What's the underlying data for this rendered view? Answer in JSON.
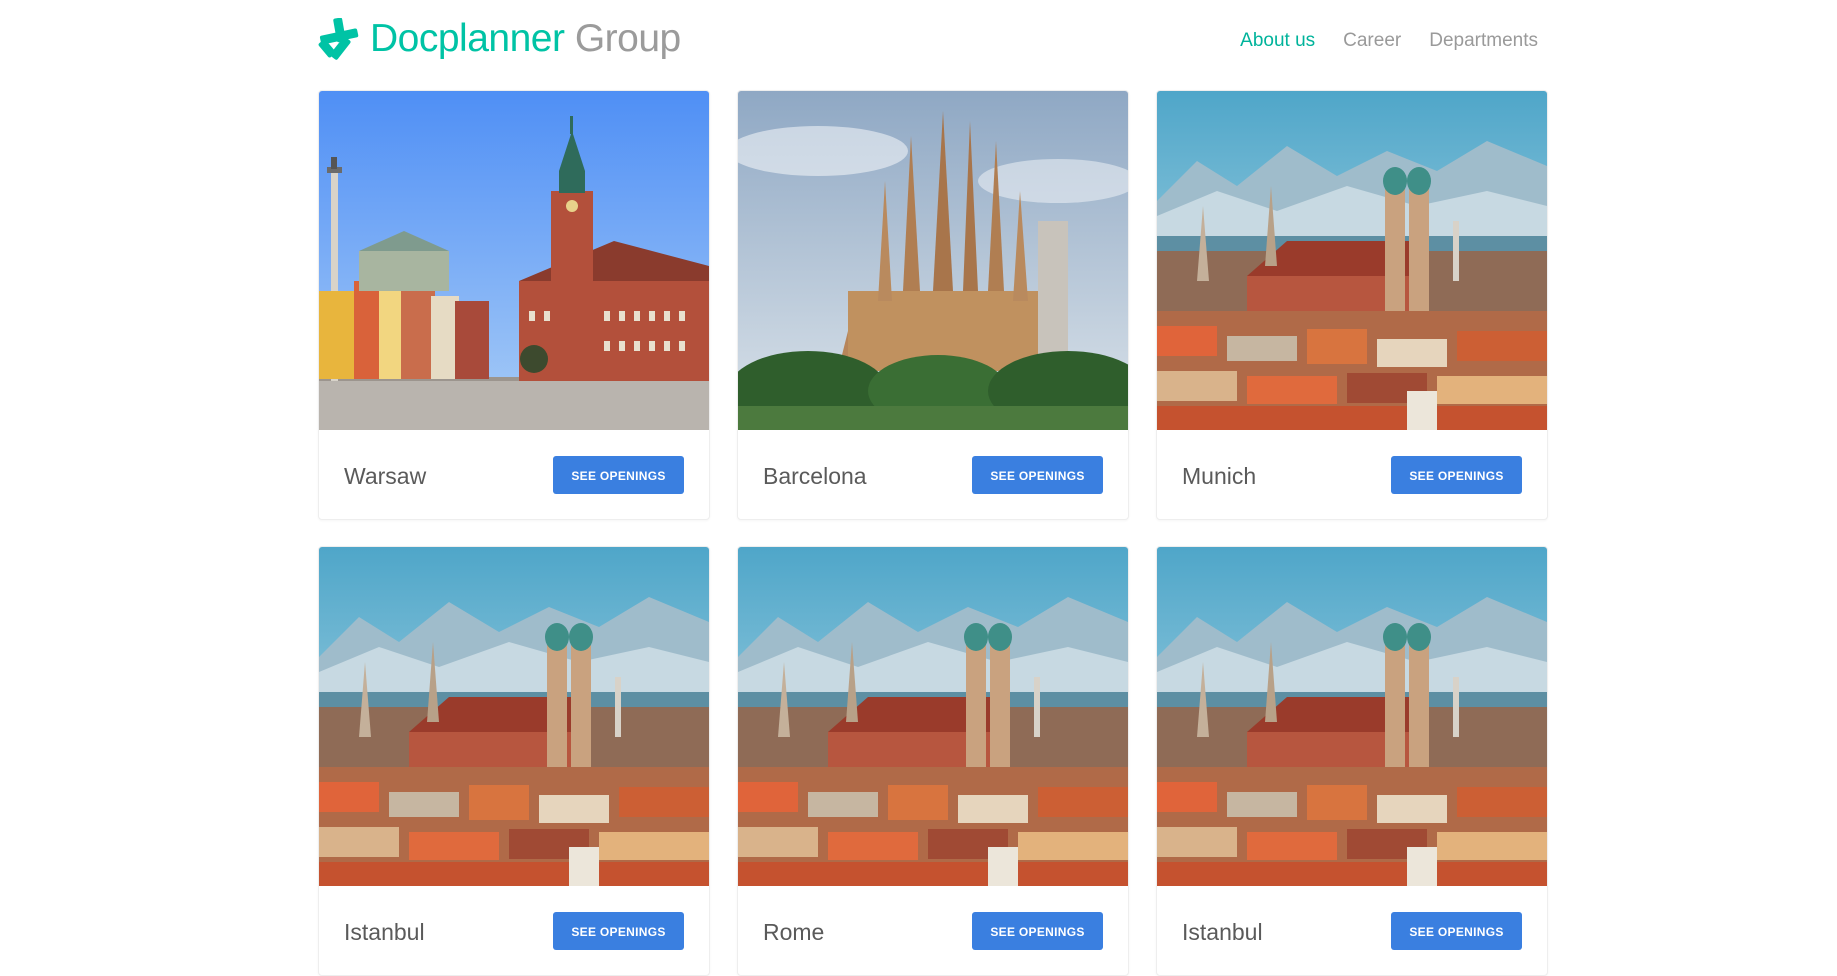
{
  "header": {
    "logo": {
      "word1": "Docplanner",
      "word2": "Group",
      "icon": "docplanner-star-icon"
    },
    "nav": [
      {
        "label": "About us",
        "active": true
      },
      {
        "label": "Career",
        "active": false
      },
      {
        "label": "Departments",
        "active": false
      }
    ]
  },
  "cards": [
    {
      "city": "Warsaw",
      "button": "SEE OPENINGS",
      "photo": "warsaw-castle-square"
    },
    {
      "city": "Barcelona",
      "button": "SEE OPENINGS",
      "photo": "barcelona-sagrada-familia"
    },
    {
      "city": "Munich",
      "button": "SEE OPENINGS",
      "photo": "munich-skyline"
    },
    {
      "city": "Istanbul",
      "button": "SEE OPENINGS",
      "photo": "munich-skyline"
    },
    {
      "city": "Rome",
      "button": "SEE OPENINGS",
      "photo": "munich-skyline"
    },
    {
      "city": "Istanbul",
      "button": "SEE OPENINGS",
      "photo": "munich-skyline"
    }
  ],
  "colors": {
    "brand_teal": "#00c3a5",
    "logo_gray": "#9b9b9b",
    "nav_active": "#00b39b",
    "nav_inactive": "#9a9a9a",
    "button_blue": "#3a7fe0"
  }
}
